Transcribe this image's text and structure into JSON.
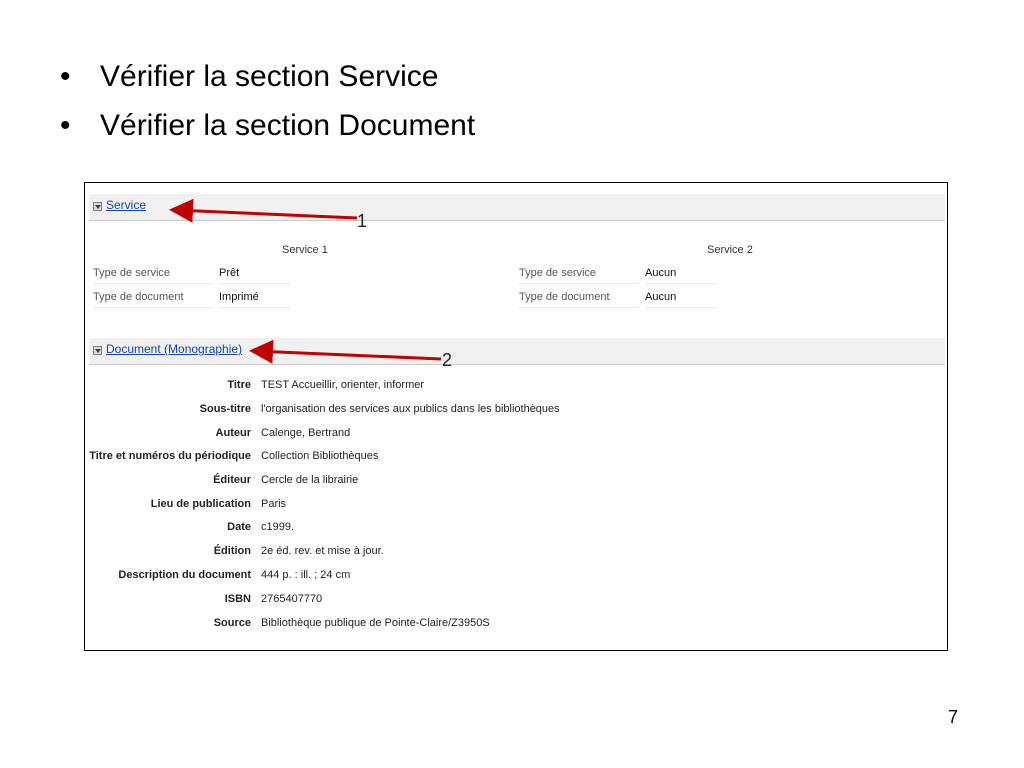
{
  "bullets": [
    "Vérifier la section Service",
    "Vérifier la section Document"
  ],
  "service_section": {
    "header": "Service",
    "columns": [
      {
        "title": "Service 1",
        "rows": [
          {
            "label": "Type de service",
            "value": "Prêt"
          },
          {
            "label": "Type de document",
            "value": "Imprimé"
          }
        ]
      },
      {
        "title": "Service 2",
        "rows": [
          {
            "label": "Type de service",
            "value": "Aucun"
          },
          {
            "label": "Type de document",
            "value": "Aucun"
          }
        ]
      }
    ]
  },
  "document_section": {
    "header": "Document (Monographie)",
    "rows": [
      {
        "label": "Titre",
        "value": "TEST Accueillir, orienter, informer"
      },
      {
        "label": "Sous-titre",
        "value": "l'organisation des services aux publics dans les bibliothèques"
      },
      {
        "label": "Auteur",
        "value": "Calenge, Bertrand"
      },
      {
        "label": "Titre et numéros du périodique",
        "value": "Collection Bibliothèques"
      },
      {
        "label": "Éditeur",
        "value": "Cercle de la librairie"
      },
      {
        "label": "Lieu de publication",
        "value": "Paris"
      },
      {
        "label": "Date",
        "value": "c1999."
      },
      {
        "label": "Édition",
        "value": "2e éd. rev. et mise à jour."
      },
      {
        "label": "Description du document",
        "value": "444 p. : ill. ; 24 cm"
      },
      {
        "label": "ISBN",
        "value": "2765407770"
      },
      {
        "label": "Source",
        "value": "Bibliothèque publique de Pointe-Claire/Z3950S"
      }
    ]
  },
  "annotations": {
    "arrow1": "1",
    "arrow2": "2"
  },
  "page_number": "7",
  "colors": {
    "arrow": "#c00000",
    "link": "#1a3fb0",
    "header_bg": "#f0f0f0"
  }
}
